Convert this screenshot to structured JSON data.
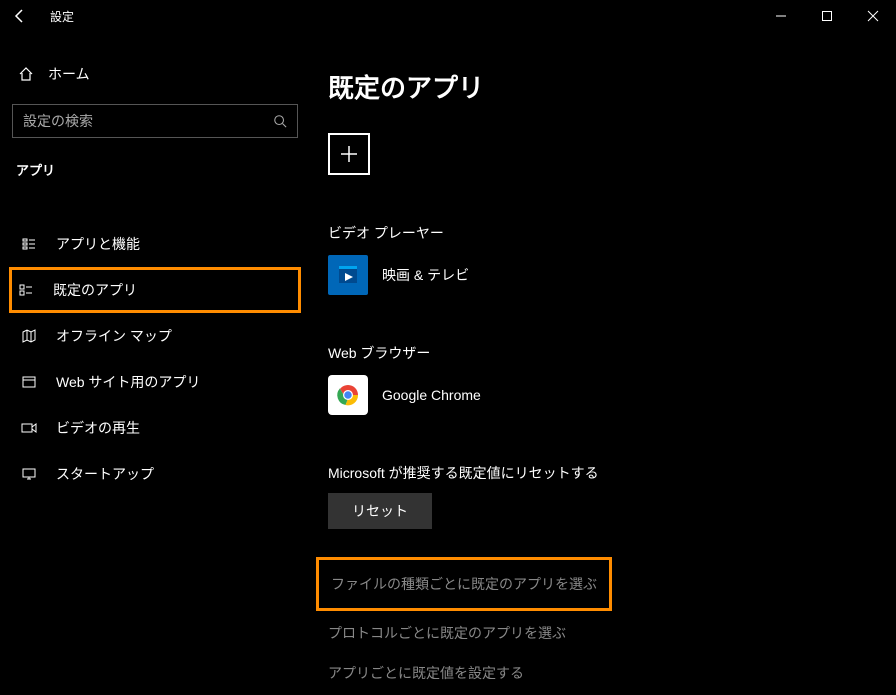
{
  "window": {
    "title": "設定"
  },
  "sidebar": {
    "home_label": "ホーム",
    "search_placeholder": "設定の検索",
    "section_header": "アプリ",
    "items": [
      {
        "label": "アプリと機能"
      },
      {
        "label": "既定のアプリ"
      },
      {
        "label": "オフライン マップ"
      },
      {
        "label": "Web サイト用のアプリ"
      },
      {
        "label": "ビデオの再生"
      },
      {
        "label": "スタートアップ"
      }
    ]
  },
  "main": {
    "page_title": "既定のアプリ",
    "categories": [
      {
        "heading": "ビデオ プレーヤー",
        "app_label": "映画 & テレビ"
      },
      {
        "heading": "Web ブラウザー",
        "app_label": "Google Chrome"
      }
    ],
    "reset_heading": "Microsoft が推奨する既定値にリセットする",
    "reset_button": "リセット",
    "links": [
      "ファイルの種類ごとに既定のアプリを選ぶ",
      "プロトコルごとに既定のアプリを選ぶ",
      "アプリごとに既定値を設定する"
    ]
  }
}
